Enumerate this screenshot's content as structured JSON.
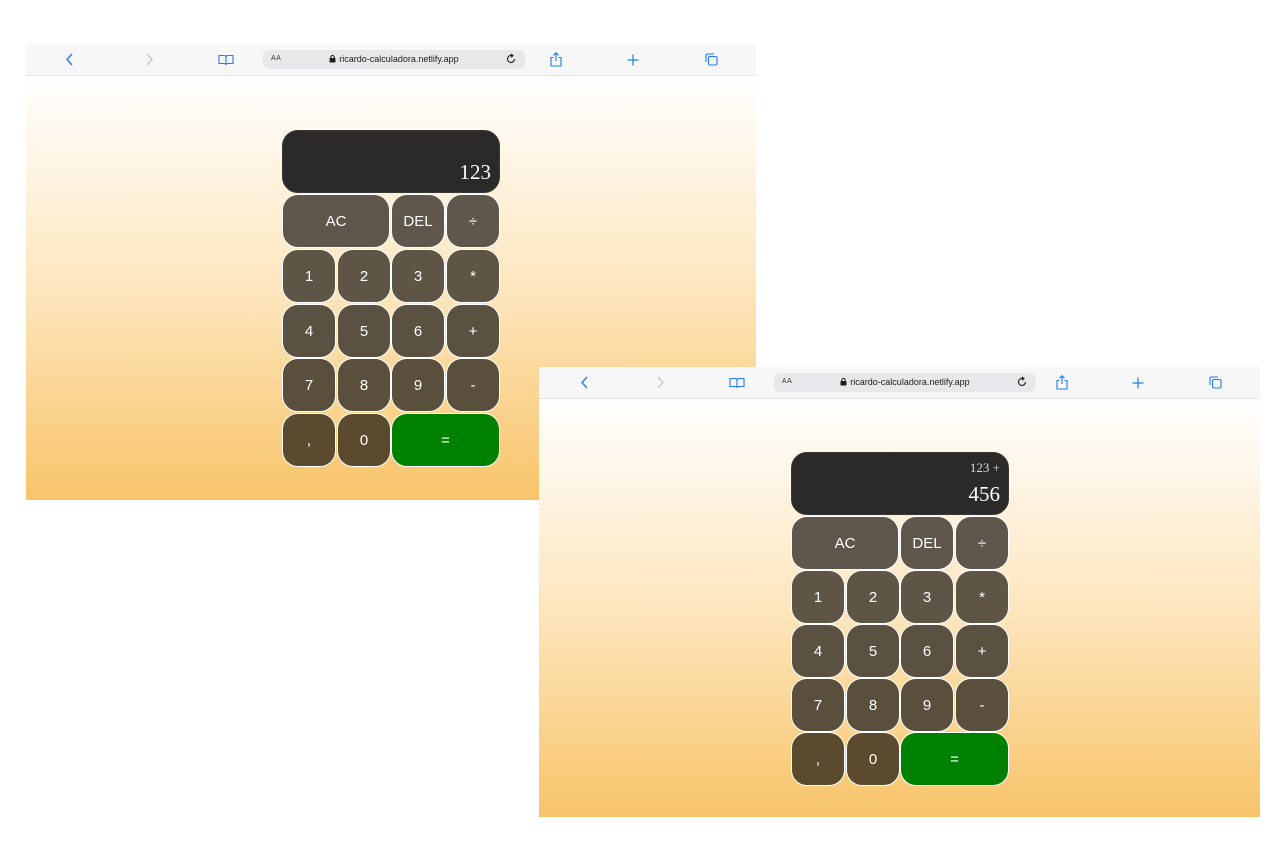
{
  "browser": {
    "text_size_label": "AA",
    "url": "ricardo-calculadora.netlify.app"
  },
  "screen1": {
    "display": {
      "previous": "",
      "current": "123"
    }
  },
  "screen2": {
    "display": {
      "previous": "123 +",
      "current": "456"
    }
  },
  "keys": {
    "ac": "AC",
    "del": "DEL",
    "divide": "÷",
    "multiply": "*",
    "add": "+",
    "subtract": "-",
    "comma": ",",
    "equals": "=",
    "d0": "0",
    "d1": "1",
    "d2": "2",
    "d3": "3",
    "d4": "4",
    "d5": "5",
    "d6": "6",
    "d7": "7",
    "d8": "8",
    "d9": "9"
  },
  "colors": {
    "ios_blue": "#1f7cf5",
    "display_bg": "#2b2a28",
    "key_bg": "#5a4f3f",
    "equals_bg": "#008000",
    "gradient_top": "#ffffff",
    "gradient_bottom": "#f8c46a"
  },
  "icons": [
    "back-chevron-icon",
    "forward-chevron-icon",
    "book-icon",
    "lock-icon",
    "reload-icon",
    "share-icon",
    "plus-icon",
    "tabs-icon"
  ]
}
